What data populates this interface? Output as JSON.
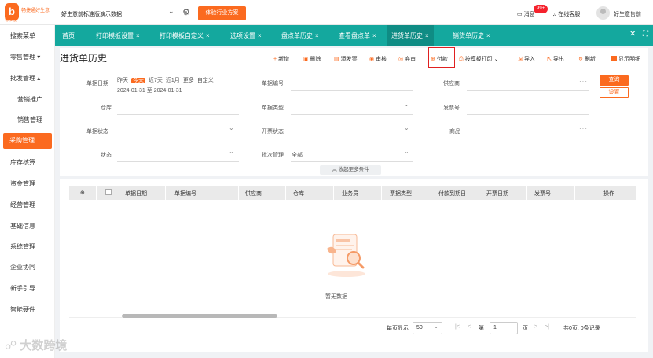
{
  "header": {
    "logo_title": "畅捷通好生意",
    "logo_sub": "标准版",
    "account": "好生意前标准版演示数据",
    "trial_button": "体验行业方案",
    "messages_label": "消息",
    "messages_badge": "99+",
    "service_label": "在线客服",
    "user_name": "好生意售前"
  },
  "sidebar": {
    "items": [
      {
        "label": "搜索菜单"
      },
      {
        "label": "零售管理 ▾"
      },
      {
        "label": "批发管理 ▴"
      },
      {
        "label": "营销推广"
      },
      {
        "label": "销售管理"
      },
      {
        "label": "采购管理"
      },
      {
        "label": "库存核算"
      },
      {
        "label": "资金管理"
      },
      {
        "label": "经营管理"
      },
      {
        "label": "基础信息"
      },
      {
        "label": "系统管理"
      },
      {
        "label": "企业协同"
      },
      {
        "label": "新手引导"
      },
      {
        "label": "智能硬件"
      }
    ]
  },
  "tabs": [
    {
      "label": "首页"
    },
    {
      "label": "打印模板设置"
    },
    {
      "label": "打印模板自定义"
    },
    {
      "label": "选项设置"
    },
    {
      "label": "盘点单历史"
    },
    {
      "label": "查看盘点单"
    },
    {
      "label": "进货单历史"
    },
    {
      "label": "销货单历史"
    }
  ],
  "tab_close": "×",
  "page": {
    "title": "进货单历史"
  },
  "toolbar": {
    "new": "新增",
    "delete": "删除",
    "add_invoice": "添发票",
    "audit": "审核",
    "discard": "弃审",
    "pay": "付款",
    "print_template": "按模板打印",
    "import": "导入",
    "export": "导出",
    "refresh": "刷新",
    "show_detail": "显示明细"
  },
  "filters": {
    "date_label": "单据日期",
    "date_options": [
      "昨天",
      "今天",
      "近7天",
      "近1月",
      "更多",
      "自定义"
    ],
    "date_range": "2024-01-31 至 2024-01-31",
    "doc_no_label": "单据编号",
    "supplier_label": "供应商",
    "warehouse_label": "仓库",
    "doc_type_label": "单据类型",
    "invoice_no_label": "发票号",
    "doc_status_label": "单据状态",
    "invoice_status_label": "开票状态",
    "product_label": "商品",
    "state_label": "状态",
    "batch_label": "批次管理",
    "batch_value": "全部",
    "query_button": "查询",
    "settings_button": "设置",
    "collapse_label": "收起更多条件"
  },
  "table": {
    "columns": [
      "单据日期",
      "单据编号",
      "供应商",
      "仓库",
      "业务员",
      "票据类型",
      "付款到期日",
      "开票日期",
      "发票号",
      "操作"
    ],
    "empty_text": "暂无数据"
  },
  "pagination": {
    "per_page_label": "每页显示",
    "per_page_value": "50",
    "page_prefix": "第",
    "page_value": "1",
    "page_suffix": "页",
    "summary": "共0页, 0条记录"
  },
  "watermark": "大数跨境",
  "colors": {
    "accent": "#fb6a1f",
    "tabbar": "#14a89e",
    "tab_active": "#0f8c84",
    "highlight_box": "#e02020"
  }
}
